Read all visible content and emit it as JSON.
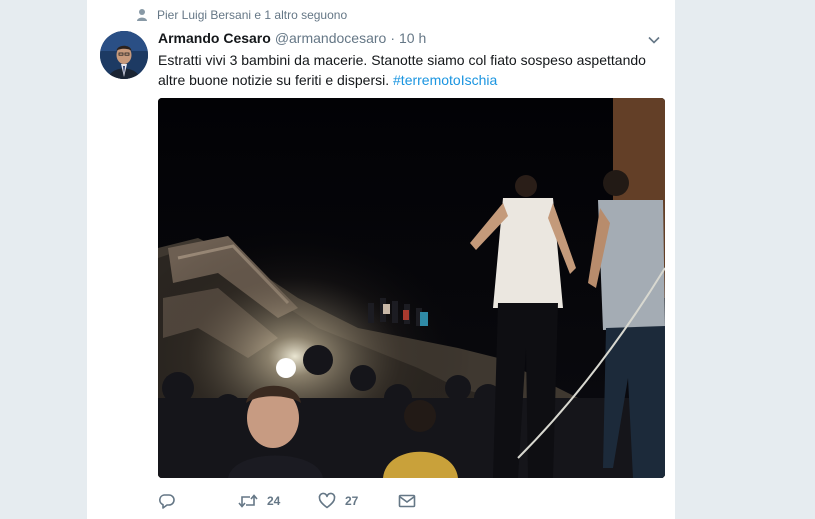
{
  "context": {
    "text": "Pier Luigi Bersani e 1 altro seguono",
    "icon": "person-icon"
  },
  "tweet": {
    "author_name": "Armando Cesaro",
    "author_handle": "@armandocesaro",
    "separator": "·",
    "time": "10 h",
    "text_part1": "Estratti vivi 3 bambini da macerie. Stanotte siamo col fiato sospeso aspettando altre buone notizie su feriti e dispersi. ",
    "hashtag": "#terremotoIschia",
    "media_description_icon": "photo"
  },
  "actions": {
    "reply_icon": "reply-icon",
    "retweet_count": "24",
    "like_count": "27",
    "dm_icon": "envelope-icon"
  },
  "colors": {
    "background": "#e6ecf0",
    "link": "#1b95e0",
    "secondary_text": "#657786"
  }
}
